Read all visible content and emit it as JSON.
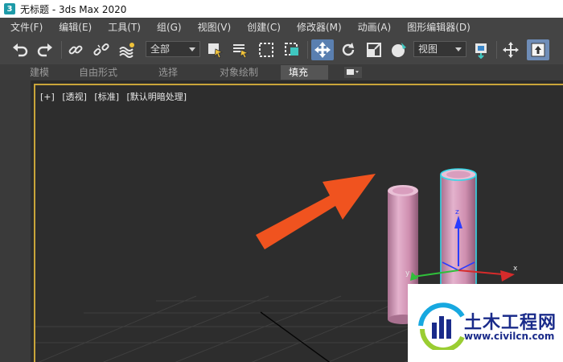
{
  "window": {
    "title": "无标题 - 3ds Max 2020",
    "app_icon_text": "3"
  },
  "menu": [
    "文件(F)",
    "编辑(E)",
    "工具(T)",
    "组(G)",
    "视图(V)",
    "创建(C)",
    "修改器(M)",
    "动画(A)",
    "图形编辑器(D)"
  ],
  "toolbar": {
    "selection_filter": "全部",
    "reference_coord": "视图",
    "icons": [
      "undo-icon",
      "redo-icon",
      "link-icon",
      "unlink-icon",
      "bind-space-warp-icon",
      "select-object-icon",
      "select-by-name-icon",
      "rectangular-selection-icon",
      "window-crossing-icon",
      "select-and-move-icon",
      "select-and-rotate-icon",
      "select-and-scale-icon",
      "select-and-place-icon",
      "use-pivot-icon",
      "select-and-manipulate-icon",
      "snaps-toggle-icon"
    ]
  },
  "ribbon": {
    "tabs": [
      "建模",
      "自由形式",
      "选择",
      "对象绘制",
      "填充"
    ],
    "selected": "填充"
  },
  "viewport": {
    "labels": [
      "[+]",
      "[透视]",
      "[标准]",
      "[默认明暗处理]"
    ],
    "border_color": "#c9a53a",
    "axes": {
      "x": "x",
      "y": "y",
      "z": "z"
    }
  },
  "scene": {
    "cylinder_color": "#d79bbb",
    "selection_outline_color": "#35d8e8",
    "arrow_color": "#f0531f"
  },
  "watermark": {
    "brand": "土木工程网",
    "url": "www.civilcn.com"
  }
}
